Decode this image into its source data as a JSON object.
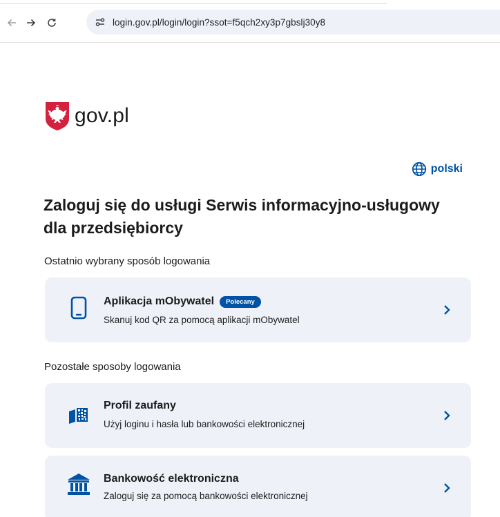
{
  "browser": {
    "url": "login.gov.pl/login/login?ssot=f5qch2xy3p7gbslj30y8"
  },
  "brand": {
    "logo_text": "gov.pl"
  },
  "language": {
    "label": "polski"
  },
  "page": {
    "heading": "Zaloguj się do usługi Serwis informacyjno-usługowy dla przedsiębiorcy",
    "recent_label": "Ostatnio wybrany sposób logowania",
    "other_label": "Pozostałe sposoby logowania"
  },
  "methods": [
    {
      "title": "Aplikacja mObywatel",
      "badge": "Polecany",
      "description": "Skanuj kod QR za pomocą aplikacji mObywatel",
      "icon": "phone-icon"
    },
    {
      "title": "Profil zaufany",
      "description": "Użyj loginu i hasła lub bankowości elektronicznej",
      "icon": "profil-zaufany-icon"
    },
    {
      "title": "Bankowość elektroniczna",
      "description": "Zaloguj się za pomocą bankowości elektronicznej",
      "icon": "bank-icon"
    }
  ],
  "colors": {
    "primary": "#0052a5",
    "card_bg": "#eef2f8",
    "emblem_red": "#d4213d"
  }
}
